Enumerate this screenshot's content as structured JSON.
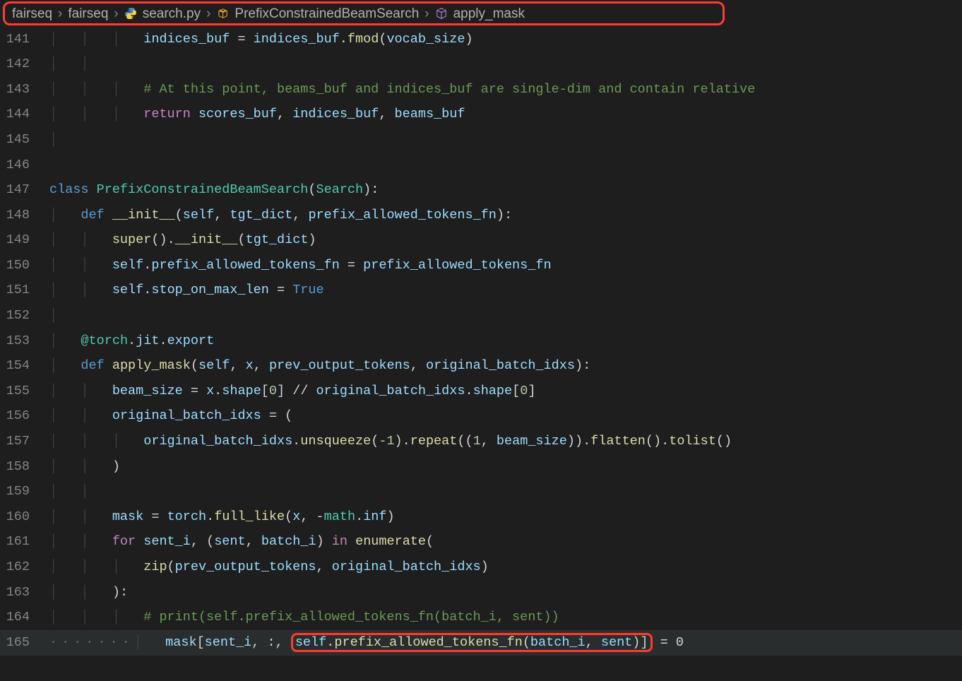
{
  "breadcrumb": {
    "seg1": "fairseq",
    "seg2": "fairseq",
    "seg3": "search.py",
    "seg4": "PrefixConstrainedBeamSearch",
    "seg5": "apply_mask"
  },
  "lines": {
    "n141": "141",
    "n142": "142",
    "n143": "143",
    "n144": "144",
    "n145": "145",
    "n146": "146",
    "n147": "147",
    "n148": "148",
    "n149": "149",
    "n150": "150",
    "n151": "151",
    "n152": "152",
    "n153": "153",
    "n154": "154",
    "n155": "155",
    "n156": "156",
    "n157": "157",
    "n158": "158",
    "n159": "159",
    "n160": "160",
    "n161": "161",
    "n162": "162",
    "n163": "163",
    "n164": "164",
    "n165": "165"
  },
  "t": {
    "indices_buf": "indices_buf",
    "eq": " = ",
    "dot": ".",
    "fmod": "fmod",
    "lp": "(",
    "rp": ")",
    "vocab_size": "vocab_size",
    "comment143": "# At this point, beams_buf and indices_buf are single-dim and contain relative",
    "return": "return ",
    "scores_buf": "scores_buf",
    "comma": ", ",
    "beams_buf": "beams_buf",
    "class": "class ",
    "PrefixConstrainedBeamSearch": "PrefixConstrainedBeamSearch",
    "Search": "Search",
    "colon": ":",
    "def": "def ",
    "init": "__init__",
    "self": "self",
    "tgt_dict": "tgt_dict",
    "prefix_allowed_tokens_fn": "prefix_allowed_tokens_fn",
    "super": "super",
    "stop_on_max_len": "stop_on_max_len",
    "True": "True",
    "at": "@",
    "torch": "torch",
    "jit": "jit",
    "export": "export",
    "apply_mask": "apply_mask",
    "x": "x",
    "prev_output_tokens": "prev_output_tokens",
    "original_batch_idxs": "original_batch_idxs",
    "beam_size": "beam_size",
    "shape": "shape",
    "lb": "[",
    "rb": "]",
    "zero": "0",
    "fl": " // ",
    "unsqueeze": "unsqueeze",
    "neg1": "-1",
    "repeat": "repeat",
    "one": "1",
    "flatten": "flatten",
    "tolist": "tolist",
    "mask": "mask",
    "full_like": "full_like",
    "neg": "-",
    "math": "math",
    "inf": "inf",
    "for": "for ",
    "sent_i": "sent_i",
    "sent": "sent",
    "batch_i": "batch_i",
    "in": " in ",
    "enumerate": "enumerate",
    "zip": "zip",
    "comment164": "# print(self.prefix_allowed_tokens_fn(batch_i, sent))",
    "slice": ":, ",
    "eq0": " = 0"
  }
}
